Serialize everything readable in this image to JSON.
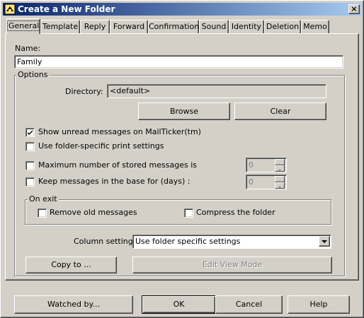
{
  "window": {
    "title": "Create a New Folder",
    "close_glyph": "×"
  },
  "tabs": [
    {
      "label": "General",
      "active": true
    },
    {
      "label": "Template"
    },
    {
      "label": "Reply"
    },
    {
      "label": "Forward"
    },
    {
      "label": "Confirmation"
    },
    {
      "label": "Sound"
    },
    {
      "label": "Identity"
    },
    {
      "label": "Deletion"
    },
    {
      "label": "Memo"
    }
  ],
  "general": {
    "name_label": "Name:",
    "name_value": "Family",
    "options_label": "Options",
    "directory_label": "Directory:",
    "directory_value": "<default>",
    "browse_label": "Browse",
    "clear_label": "Clear",
    "show_unread_label": "Show unread messages on MailTicker(tm)",
    "show_unread_checked": true,
    "print_settings_label": "Use folder-specific print settings",
    "print_settings_checked": false,
    "max_messages_label": "Maximum number of stored messages is",
    "max_messages_checked": false,
    "max_messages_value": "0",
    "keep_days_label": "Keep messages in the base for (days) :",
    "keep_days_checked": false,
    "keep_days_value": "0",
    "on_exit_label": "On exit",
    "remove_old_label": "Remove old messages",
    "remove_old_checked": false,
    "compress_label": "Compress the folder",
    "compress_checked": false,
    "column_settings_label": "Column settings:",
    "column_settings_value": "Use folder specific settings",
    "copy_to_label": "Copy to ...",
    "edit_view_label": "Edit View Mode"
  },
  "footer": {
    "watched_by_label": "Watched by...",
    "ok_label": "OK",
    "cancel_label": "Cancel",
    "help_label": "Help"
  },
  "colors": {
    "face": "#d4d0c8",
    "title_start": "#0a246a",
    "title_end": "#a6caf0",
    "disabled_text": "#808080"
  }
}
